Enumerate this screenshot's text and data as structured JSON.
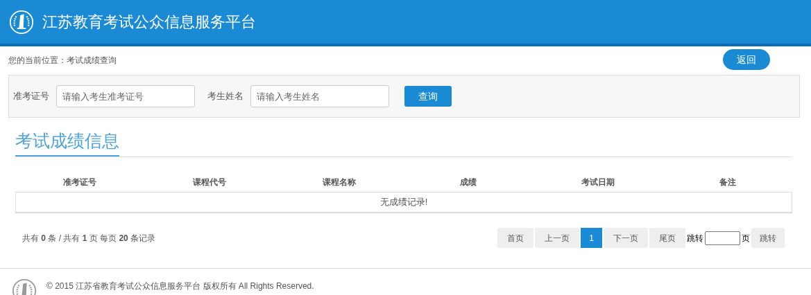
{
  "header": {
    "title": "江苏教育考试公众信息服务平台"
  },
  "breadcrumb": "您的当前位置：考试成绩查询",
  "back_button": "返回",
  "search": {
    "fields": [
      {
        "label": "准考证号",
        "placeholder": "请输入考生准考证号"
      },
      {
        "label": "考生姓名",
        "placeholder": "请输入考生姓名"
      }
    ],
    "button": "查询"
  },
  "section_title": "考试成绩信息",
  "table": {
    "columns": [
      "准考证号",
      "课程代号",
      "课程名称",
      "成绩",
      "考试日期",
      "备注"
    ],
    "empty_message": "无成绩记录!"
  },
  "pagination": {
    "summary": "共有 **0** 条 / 共有 **1** 页 每页 **20** 条记录",
    "pages": [
      {
        "label": "首页",
        "selected": false
      },
      {
        "label": "上一页",
        "selected": false
      },
      {
        "label": "1",
        "selected": true
      },
      {
        "label": "下一页",
        "selected": false
      },
      {
        "label": "尾页",
        "selected": false
      }
    ],
    "jump_label": "跳转",
    "jump_suffix": "页",
    "jump_button": "跳转"
  },
  "footer": {
    "copyright": "© 2015 江苏省教育考试公众信息服务平台 版权所有 All Rights Reserved."
  }
}
